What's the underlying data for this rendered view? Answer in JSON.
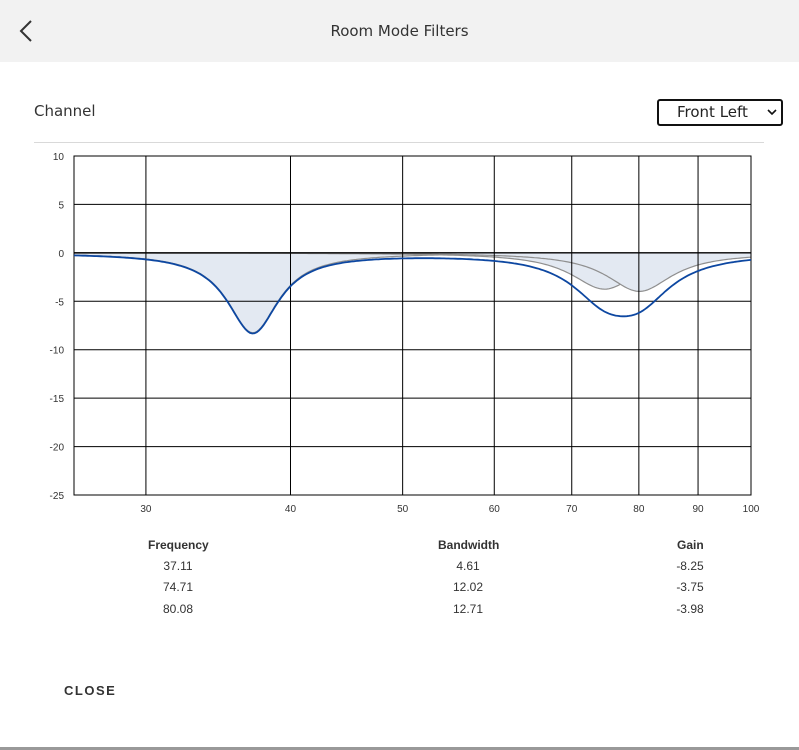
{
  "header": {
    "title": "Room Mode Filters",
    "back_icon": "chevron-left-icon"
  },
  "channel": {
    "label": "Channel",
    "selected": "Front Left"
  },
  "chart_data": {
    "type": "line",
    "title": "",
    "xlabel": "",
    "ylabel": "",
    "xscale": "log",
    "xlim": [
      26,
      100
    ],
    "ylim": [
      -25,
      10
    ],
    "x_ticks": [
      30,
      40,
      50,
      60,
      70,
      80,
      90,
      100
    ],
    "y_ticks": [
      10,
      5,
      0,
      -5,
      -10,
      -15,
      -20,
      -25
    ],
    "grid": true,
    "filters": [
      {
        "frequency": 37.11,
        "bandwidth": 4.61,
        "gain": -8.25
      },
      {
        "frequency": 74.71,
        "bandwidth": 12.02,
        "gain": -3.75
      },
      {
        "frequency": 80.08,
        "bandwidth": 12.71,
        "gain": -3.98
      }
    ],
    "colors": {
      "combined": "#0d47a1",
      "individual": "#8f8f8f",
      "fill": "#e3e9f2",
      "grid": "#000000"
    }
  },
  "table": {
    "headers": {
      "frequency": "Frequency",
      "bandwidth": "Bandwidth",
      "gain": "Gain"
    },
    "rows": [
      {
        "frequency": "37.11",
        "bandwidth": "4.61",
        "gain": "-8.25"
      },
      {
        "frequency": "74.71",
        "bandwidth": "12.02",
        "gain": "-3.75"
      },
      {
        "frequency": "80.08",
        "bandwidth": "12.71",
        "gain": "-3.98"
      }
    ]
  },
  "footer": {
    "close_label": "CLOSE"
  }
}
